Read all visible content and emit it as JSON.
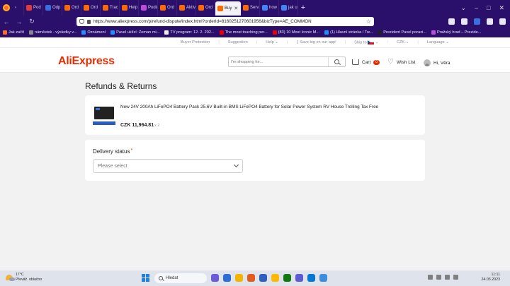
{
  "browser": {
    "tabs": [
      {
        "label": "Pod",
        "color": "#e03a3a"
      },
      {
        "label": "Odp",
        "color": "#3a6fe0"
      },
      {
        "label": "Ord",
        "color": "#ff6a00"
      },
      {
        "label": "Ord",
        "color": "#ff6a00"
      },
      {
        "label": "Trac",
        "color": "#ff6a00"
      },
      {
        "label": "Help",
        "color": "#ff6a00"
      },
      {
        "label": "Podlá",
        "color": "#c04bd8"
      },
      {
        "label": "Ord",
        "color": "#ff6a00"
      },
      {
        "label": "Aktiv",
        "color": "#ff6a00"
      },
      {
        "label": "Ord",
        "color": "#ff6a00"
      },
      {
        "label": "Buy",
        "color": "#ff6a00",
        "active": true
      },
      {
        "label": "Serv",
        "color": "#ff6a00"
      },
      {
        "label": "how",
        "color": "#4285f4"
      },
      {
        "label": "jak u",
        "color": "#4285f4"
      }
    ],
    "url": "https://www.aliexpress.com/p/refund-dispute/index.html?orderId=8160251270601956&bizType=AE_COMMON",
    "bookmarks": [
      {
        "label": "Jak začít",
        "color": "#ff6a2a"
      },
      {
        "label": "náměstek - výsledky v...",
        "color": "#888"
      },
      {
        "label": "Oznámení",
        "color": "#1e90ff"
      },
      {
        "label": "Pavel uklízí: Zeman mi...",
        "color": "#1e90ff"
      },
      {
        "label": "TV program: 12. 2. 202...",
        "color": "#eee"
      },
      {
        "label": "The most touching per...",
        "color": "#e00"
      },
      {
        "label": "(83) 10 Most Iconic M...",
        "color": "#e00"
      },
      {
        "label": "(1) Hlavní stránka / Tw...",
        "color": "#1e90ff"
      },
      {
        "label": "Prezident Pavel porazi...",
        "color": "#222"
      },
      {
        "label": "Pražský hrad – Prezide...",
        "color": "#c04bd8"
      }
    ]
  },
  "site": {
    "topbar": {
      "buyer_protection": "Buyer Protection",
      "suggestion": "Suggestion",
      "help": "Help",
      "app": "Save big on our app!",
      "ship_to": "Ship to",
      "currency": "CZK",
      "language": "Language"
    },
    "logo": "AliExpress",
    "search_placeholder": "I'm shopping for...",
    "cart_label": "Cart",
    "cart_count": "0",
    "wishlist_label": "Wish List",
    "greeting": "Hi, Věra"
  },
  "page": {
    "title": "Refunds & Returns",
    "product": {
      "title": "New 24V 200Ah LiFePO4 Battery Pack 25.6V Built-in BMS LiFePO4 Battery for Solar Power System RV House Trolling Tax Free",
      "price": "CZK 11,964.81",
      "qty": "x 2"
    },
    "delivery": {
      "label": "Delivery status",
      "required_mark": "*",
      "placeholder": "Please select"
    }
  },
  "taskbar": {
    "weather_temp": "17°C",
    "weather_desc": "Převáž. oblačno",
    "search": "Hledat",
    "time": "11:11",
    "date": "24.03.2023",
    "app_colors": [
      "#6b5bd6",
      "#2b6fd6",
      "#f4b400",
      "#e45b1e",
      "#2f5fbf",
      "#ffb900",
      "#0f7b0f",
      "#5b5bd6",
      "#0078d4",
      "#3c8dde"
    ]
  }
}
